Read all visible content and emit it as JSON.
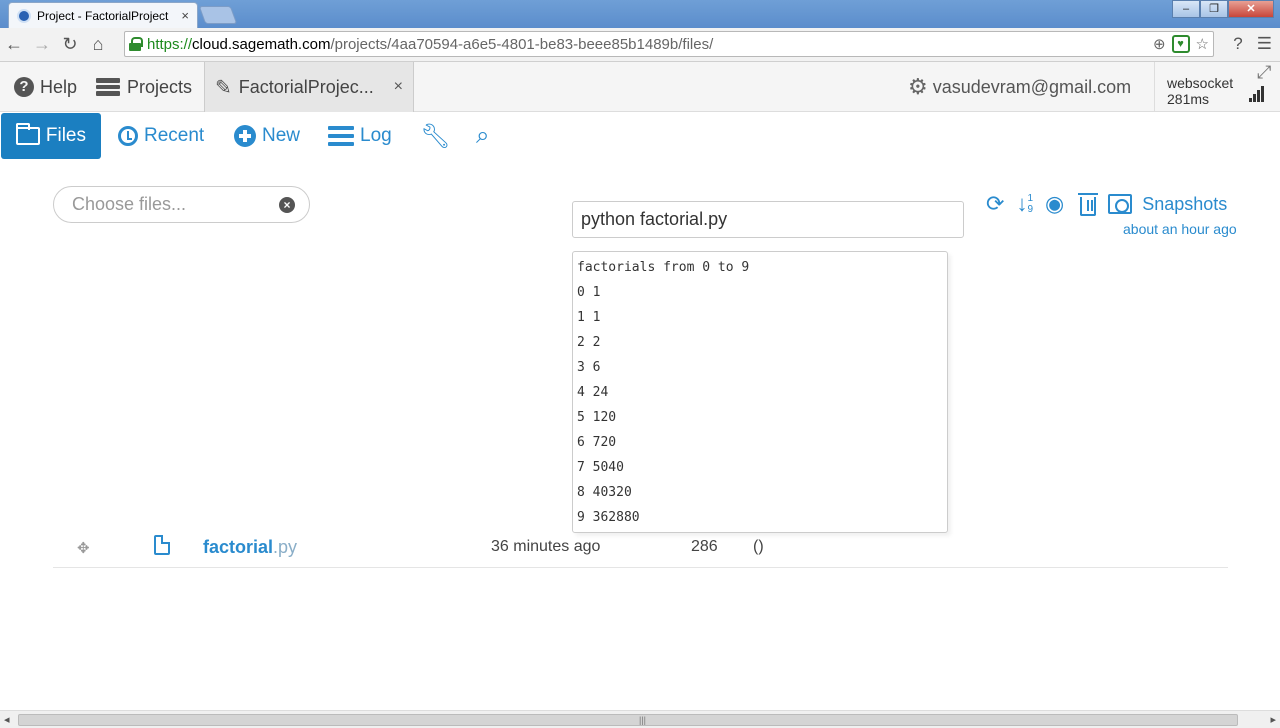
{
  "browser": {
    "tab_title": "Project - FactorialProject",
    "tab_close": "×",
    "url_scheme": "https://",
    "url_host": "cloud.sagemath.com",
    "url_path": "/projects/4aa70594-a6e5-4801-be83-beee85b1489b/files/"
  },
  "appbar": {
    "help_label": "Help",
    "projects_label": "Projects",
    "project_tab_label": "FactorialProjec...",
    "project_tab_close": "×",
    "user_email": "vasudevram@gmail.com",
    "connection_type": "websocket",
    "connection_latency": "281ms"
  },
  "actions": {
    "files_label": "Files",
    "recent_label": "Recent",
    "new_label": "New",
    "log_label": "Log"
  },
  "search": {
    "placeholder": "Choose files..."
  },
  "command": {
    "value": "python factorial.py"
  },
  "output": {
    "lines": [
      "factorials from 0 to 9",
      "0 1",
      "1 1",
      "2 2",
      "3 6",
      "4 24",
      "5 120",
      "6 720",
      "7 5040",
      "8 40320",
      "9 362880"
    ]
  },
  "tools": {
    "sort_top": "1",
    "sort_bottom": "9",
    "snapshots_label": "Snapshots",
    "snapshots_time": "about an hour ago"
  },
  "files": [
    {
      "name_base": "factorial",
      "name_ext": ".py",
      "modified": "36 minutes ago",
      "size": "286",
      "extra": "()"
    }
  ],
  "colors": {
    "accent": "#2a8bce",
    "active_tab": "#1b7fc1",
    "secure_green": "#1e8a1e"
  }
}
